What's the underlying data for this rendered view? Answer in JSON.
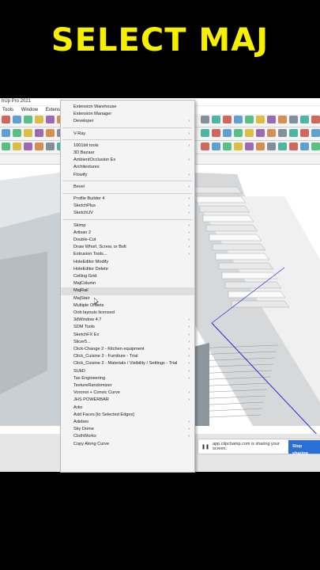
{
  "headline": "SELECT MAJ",
  "window": {
    "title": "hUp Pro 2021"
  },
  "menubar": [
    "Tools",
    "Window",
    "Extensions"
  ],
  "share": {
    "text": "app.clipchamp.com is sharing your screen.",
    "stop": "Stop sharing"
  },
  "menu": {
    "groups": [
      {
        "items": [
          {
            "label": "Extension Warehouse",
            "submenu": false
          },
          {
            "label": "Extension Manager",
            "submenu": false
          },
          {
            "label": "Developer",
            "submenu": true
          }
        ]
      },
      {
        "items": [
          {
            "label": "V-Ray",
            "submenu": true
          }
        ]
      },
      {
        "items": [
          {
            "label": "1001bit tools",
            "submenu": true
          },
          {
            "label": "3D Bazaar",
            "submenu": false
          },
          {
            "label": "AmbientOcclusion Ex",
            "submenu": true
          },
          {
            "label": "Architextures",
            "submenu": false
          },
          {
            "label": "Flowify",
            "submenu": true
          }
        ]
      },
      {
        "items": [
          {
            "label": "Bevel",
            "submenu": true
          }
        ]
      },
      {
        "items": [
          {
            "label": "Profile Builder 4",
            "submenu": true
          },
          {
            "label": "SketchPlus",
            "submenu": true
          },
          {
            "label": "SketchUV",
            "submenu": true
          }
        ]
      },
      {
        "items": [
          {
            "label": "Skimp",
            "submenu": true
          },
          {
            "label": "Artisan 2",
            "submenu": true
          },
          {
            "label": "Double-Cut",
            "submenu": true
          },
          {
            "label": "Draw Whorl, Screw, or Bolt",
            "submenu": true
          },
          {
            "label": "Extrusion Tools...",
            "submenu": true
          },
          {
            "label": "HoleEditor Modify",
            "submenu": false
          },
          {
            "label": "HoleEditor Delete",
            "submenu": false
          },
          {
            "label": "Ceiling Grid",
            "submenu": false
          },
          {
            "label": "MajColumn",
            "submenu": false
          },
          {
            "label": "MajRail",
            "submenu": false,
            "hover": true
          },
          {
            "label": "MajStair",
            "submenu": false
          },
          {
            "label": "Multiple Offsets",
            "submenu": false
          },
          {
            "label": "Oob layouts licensed",
            "submenu": false
          },
          {
            "label": "3dWindow 4.7",
            "submenu": true
          },
          {
            "label": "SDM Tools",
            "submenu": true
          },
          {
            "label": "SketchFX Ex",
            "submenu": true
          },
          {
            "label": "Slicer5...",
            "submenu": true
          },
          {
            "label": "Click-Change 2 - Kitchen equipment",
            "submenu": true
          },
          {
            "label": "Click_Cuisine 2 - Furniture - Trial",
            "submenu": true
          },
          {
            "label": "Click_Cuisine 2 - Materials / Visibility / Settings - Trial",
            "submenu": true
          },
          {
            "label": "SUbD",
            "submenu": true
          },
          {
            "label": "Tax Engineering",
            "submenu": true
          },
          {
            "label": "TextureRandomizer",
            "submenu": false
          },
          {
            "label": "Voronoi + Convic Curve",
            "submenu": true
          },
          {
            "label": "JHS POWERBAR",
            "submenu": true
          },
          {
            "label": "Arko",
            "submenu": false
          },
          {
            "label": "Add Faces [to Selected Edges]",
            "submenu": false
          },
          {
            "label": "Adebeo",
            "submenu": true
          },
          {
            "label": "Sky Dome",
            "submenu": true
          },
          {
            "label": "ClothWorks",
            "submenu": true
          },
          {
            "label": "Copy Along Curve",
            "submenu": false
          }
        ]
      }
    ]
  },
  "colors": {
    "headline": "#f6f000",
    "accent": "#2a6ed8",
    "selection_line": "#2a2ad8"
  }
}
